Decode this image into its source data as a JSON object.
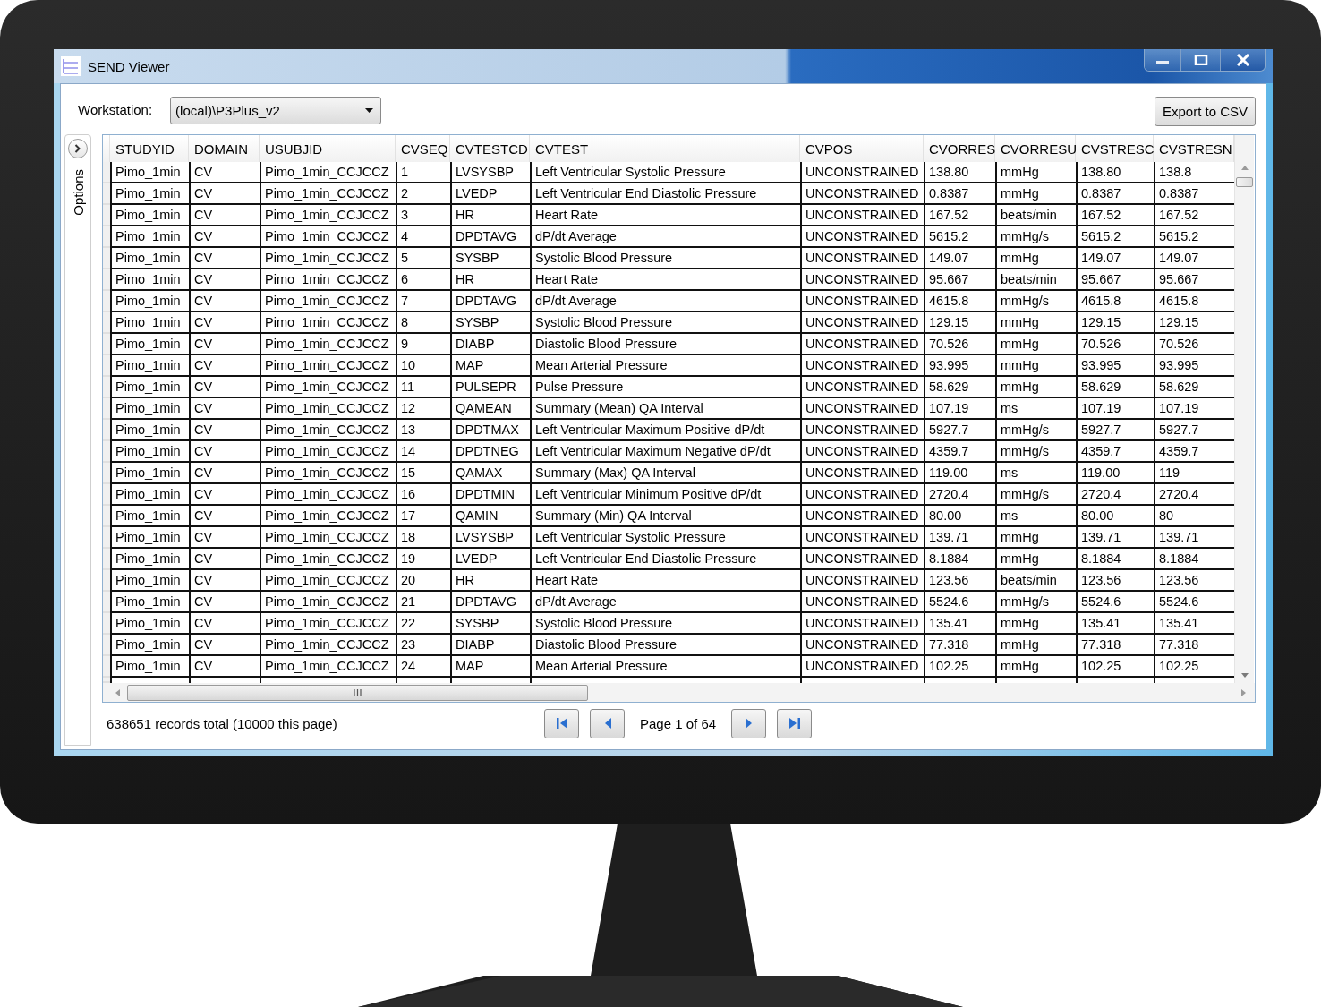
{
  "window": {
    "title": "SEND Viewer"
  },
  "toolbar": {
    "workstation_label": "Workstation:",
    "workstation_value": "(local)\\P3Plus_v2",
    "export_button": "Export to CSV"
  },
  "options_panel": {
    "label": "Options"
  },
  "table": {
    "columns": [
      "STUDYID",
      "DOMAIN",
      "USUBJID",
      "CVSEQ",
      "CVTESTCD",
      "CVTEST",
      "CVPOS",
      "CVORRES",
      "CVORRESU",
      "CVSTRESC",
      "CVSTRESN"
    ],
    "rows": [
      [
        "Pimo_1min",
        "CV",
        "Pimo_1min_CCJCCZ",
        "1",
        "LVSYSBP",
        "Left Ventricular Systolic Pressure",
        "UNCONSTRAINED",
        "138.80",
        "mmHg",
        "138.80",
        "138.8"
      ],
      [
        "Pimo_1min",
        "CV",
        "Pimo_1min_CCJCCZ",
        "2",
        "LVEDP",
        "Left Ventricular End Diastolic Pressure",
        "UNCONSTRAINED",
        "0.8387",
        "mmHg",
        "0.8387",
        "0.8387"
      ],
      [
        "Pimo_1min",
        "CV",
        "Pimo_1min_CCJCCZ",
        "3",
        "HR",
        "Heart Rate",
        "UNCONSTRAINED",
        "167.52",
        "beats/min",
        "167.52",
        "167.52"
      ],
      [
        "Pimo_1min",
        "CV",
        "Pimo_1min_CCJCCZ",
        "4",
        "DPDTAVG",
        "dP/dt Average",
        "UNCONSTRAINED",
        "5615.2",
        "mmHg/s",
        "5615.2",
        "5615.2"
      ],
      [
        "Pimo_1min",
        "CV",
        "Pimo_1min_CCJCCZ",
        "5",
        "SYSBP",
        "Systolic Blood Pressure",
        "UNCONSTRAINED",
        "149.07",
        "mmHg",
        "149.07",
        "149.07"
      ],
      [
        "Pimo_1min",
        "CV",
        "Pimo_1min_CCJCCZ",
        "6",
        "HR",
        "Heart Rate",
        "UNCONSTRAINED",
        "95.667",
        "beats/min",
        "95.667",
        "95.667"
      ],
      [
        "Pimo_1min",
        "CV",
        "Pimo_1min_CCJCCZ",
        "7",
        "DPDTAVG",
        "dP/dt Average",
        "UNCONSTRAINED",
        "4615.8",
        "mmHg/s",
        "4615.8",
        "4615.8"
      ],
      [
        "Pimo_1min",
        "CV",
        "Pimo_1min_CCJCCZ",
        "8",
        "SYSBP",
        "Systolic Blood Pressure",
        "UNCONSTRAINED",
        "129.15",
        "mmHg",
        "129.15",
        "129.15"
      ],
      [
        "Pimo_1min",
        "CV",
        "Pimo_1min_CCJCCZ",
        "9",
        "DIABP",
        "Diastolic Blood Pressure",
        "UNCONSTRAINED",
        "70.526",
        "mmHg",
        "70.526",
        "70.526"
      ],
      [
        "Pimo_1min",
        "CV",
        "Pimo_1min_CCJCCZ",
        "10",
        "MAP",
        "Mean Arterial Pressure",
        "UNCONSTRAINED",
        "93.995",
        "mmHg",
        "93.995",
        "93.995"
      ],
      [
        "Pimo_1min",
        "CV",
        "Pimo_1min_CCJCCZ",
        "11",
        "PULSEPR",
        "Pulse Pressure",
        "UNCONSTRAINED",
        "58.629",
        "mmHg",
        "58.629",
        "58.629"
      ],
      [
        "Pimo_1min",
        "CV",
        "Pimo_1min_CCJCCZ",
        "12",
        "QAMEAN",
        "Summary (Mean) QA Interval",
        "UNCONSTRAINED",
        "107.19",
        "ms",
        "107.19",
        "107.19"
      ],
      [
        "Pimo_1min",
        "CV",
        "Pimo_1min_CCJCCZ",
        "13",
        "DPDTMAX",
        "Left Ventricular Maximum Positive dP/dt",
        "UNCONSTRAINED",
        "5927.7",
        "mmHg/s",
        "5927.7",
        "5927.7"
      ],
      [
        "Pimo_1min",
        "CV",
        "Pimo_1min_CCJCCZ",
        "14",
        "DPDTNEG",
        "Left Ventricular Maximum Negative dP/dt",
        "UNCONSTRAINED",
        "4359.7",
        "mmHg/s",
        "4359.7",
        "4359.7"
      ],
      [
        "Pimo_1min",
        "CV",
        "Pimo_1min_CCJCCZ",
        "15",
        "QAMAX",
        "Summary (Max) QA Interval",
        "UNCONSTRAINED",
        "119.00",
        "ms",
        "119.00",
        "119"
      ],
      [
        "Pimo_1min",
        "CV",
        "Pimo_1min_CCJCCZ",
        "16",
        "DPDTMIN",
        "Left Ventricular Minimum Positive dP/dt",
        "UNCONSTRAINED",
        "2720.4",
        "mmHg/s",
        "2720.4",
        "2720.4"
      ],
      [
        "Pimo_1min",
        "CV",
        "Pimo_1min_CCJCCZ",
        "17",
        "QAMIN",
        "Summary (Min) QA Interval",
        "UNCONSTRAINED",
        "80.00",
        "ms",
        "80.00",
        "80"
      ],
      [
        "Pimo_1min",
        "CV",
        "Pimo_1min_CCJCCZ",
        "18",
        "LVSYSBP",
        "Left Ventricular Systolic Pressure",
        "UNCONSTRAINED",
        "139.71",
        "mmHg",
        "139.71",
        "139.71"
      ],
      [
        "Pimo_1min",
        "CV",
        "Pimo_1min_CCJCCZ",
        "19",
        "LVEDP",
        "Left Ventricular End Diastolic Pressure",
        "UNCONSTRAINED",
        "8.1884",
        "mmHg",
        "8.1884",
        "8.1884"
      ],
      [
        "Pimo_1min",
        "CV",
        "Pimo_1min_CCJCCZ",
        "20",
        "HR",
        "Heart Rate",
        "UNCONSTRAINED",
        "123.56",
        "beats/min",
        "123.56",
        "123.56"
      ],
      [
        "Pimo_1min",
        "CV",
        "Pimo_1min_CCJCCZ",
        "21",
        "DPDTAVG",
        "dP/dt Average",
        "UNCONSTRAINED",
        "5524.6",
        "mmHg/s",
        "5524.6",
        "5524.6"
      ],
      [
        "Pimo_1min",
        "CV",
        "Pimo_1min_CCJCCZ",
        "22",
        "SYSBP",
        "Systolic Blood Pressure",
        "UNCONSTRAINED",
        "135.41",
        "mmHg",
        "135.41",
        "135.41"
      ],
      [
        "Pimo_1min",
        "CV",
        "Pimo_1min_CCJCCZ",
        "23",
        "DIABP",
        "Diastolic Blood Pressure",
        "UNCONSTRAINED",
        "77.318",
        "mmHg",
        "77.318",
        "77.318"
      ],
      [
        "Pimo_1min",
        "CV",
        "Pimo_1min_CCJCCZ",
        "24",
        "MAP",
        "Mean Arterial Pressure",
        "UNCONSTRAINED",
        "102.25",
        "mmHg",
        "102.25",
        "102.25"
      ]
    ]
  },
  "footer": {
    "records": "638651 records total  (10000 this page)",
    "page": "Page 1 of 64"
  }
}
